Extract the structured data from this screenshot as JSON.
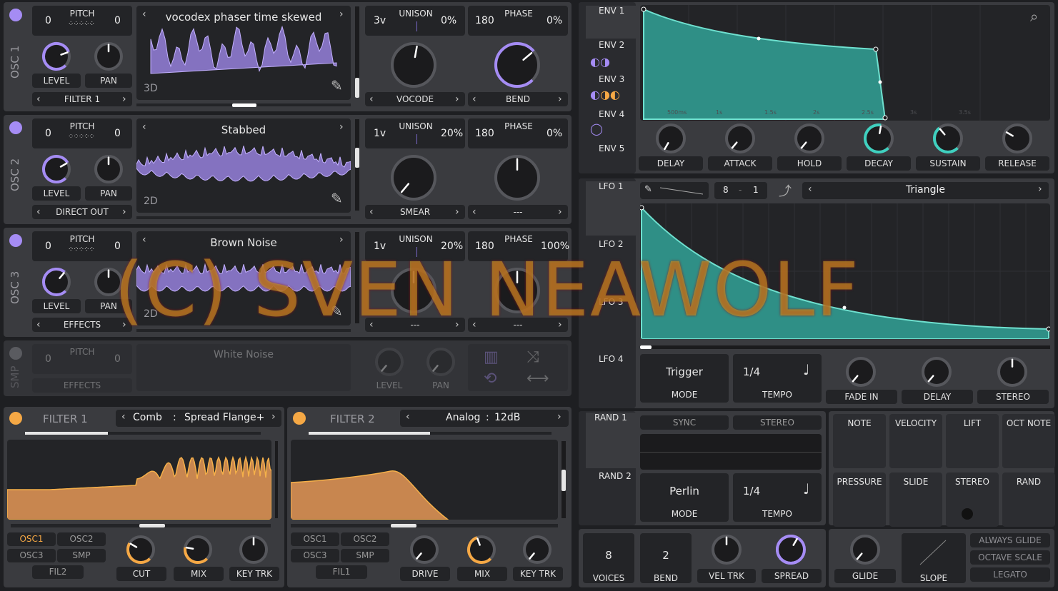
{
  "osc": [
    {
      "title": "OSC 1",
      "pitch_label": "PITCH",
      "pitch_left": "0",
      "pitch_right": "0",
      "level": "LEVEL",
      "pan": "PAN",
      "dest": "FILTER 1",
      "wave_name": "vocodex phaser time skewed",
      "mode": "3D",
      "unison_label": "UNISON",
      "voices": "3v",
      "detune": "0%",
      "phase_label": "PHASE",
      "phase": "180",
      "phase_rand": "0%",
      "knob1": "VOCODE",
      "knob2": "BEND"
    },
    {
      "title": "OSC 2",
      "pitch_label": "PITCH",
      "pitch_left": "0",
      "pitch_right": "0",
      "level": "LEVEL",
      "pan": "PAN",
      "dest": "DIRECT OUT",
      "wave_name": "Stabbed",
      "mode": "2D",
      "unison_label": "UNISON",
      "voices": "1v",
      "detune": "20%",
      "phase_label": "PHASE",
      "phase": "180",
      "phase_rand": "0%",
      "knob1": "SMEAR",
      "knob2": "---"
    },
    {
      "title": "OSC 3",
      "pitch_label": "PITCH",
      "pitch_left": "0",
      "pitch_right": "0",
      "level": "LEVEL",
      "pan": "PAN",
      "dest": "EFFECTS",
      "wave_name": "Brown Noise",
      "mode": "2D",
      "unison_label": "UNISON",
      "voices": "1v",
      "detune": "20%",
      "phase_label": "PHASE",
      "phase": "180",
      "phase_rand": "100%",
      "knob1": "---",
      "knob2": "---"
    }
  ],
  "smp": {
    "title": "SMP",
    "pitch_label": "PITCH",
    "pitch_left": "0",
    "pitch_right": "0",
    "dest": "EFFECTS",
    "sample": "White Noise",
    "level": "LEVEL",
    "pan": "PAN"
  },
  "filter1": {
    "title": "FILTER 1",
    "type": "Comb",
    "sep": ":",
    "model": "Spread Flange+",
    "routes": [
      "OSC1",
      "OSC2",
      "OSC3",
      "SMP",
      "FIL2"
    ],
    "knobs": [
      "CUT",
      "MIX",
      "KEY TRK"
    ]
  },
  "filter2": {
    "title": "FILTER 2",
    "type": "Analog",
    "sep": ":",
    "model": "12dB",
    "routes": [
      "OSC1",
      "OSC2",
      "OSC3",
      "SMP",
      "FIL1"
    ],
    "knobs": [
      "DRIVE",
      "MIX",
      "KEY TRK"
    ]
  },
  "env": {
    "tabs": [
      "ENV 1",
      "ENV 2",
      "ENV 3",
      "ENV 4",
      "ENV 5"
    ],
    "knobs": [
      "DELAY",
      "ATTACK",
      "HOLD",
      "DECAY",
      "SUSTAIN",
      "RELEASE"
    ],
    "grid": [
      "500ms",
      "1s",
      "1.5s",
      "2s",
      "2.5s",
      "3s",
      "3.5s"
    ]
  },
  "lfo": {
    "tabs": [
      "LFO 1",
      "LFO 2",
      "LFO 3",
      "LFO 4"
    ],
    "rate_num": "8",
    "rate_sep": "-",
    "rate_den": "1",
    "shape": "Triangle",
    "mode_value": "Trigger",
    "mode_label": "MODE",
    "tempo_value": "1/4",
    "tempo_label": "TEMPO",
    "knobs": [
      "FADE IN",
      "DELAY",
      "STEREO"
    ]
  },
  "rand": {
    "tabs": [
      "RAND 1",
      "RAND 2"
    ],
    "sync": "SYNC",
    "stereo": "STEREO",
    "mode_value": "Perlin",
    "mode_label": "MODE",
    "tempo_value": "1/4",
    "tempo_label": "TEMPO"
  },
  "mods": [
    "NOTE",
    "VELOCITY",
    "LIFT",
    "OCT NOTE",
    "PRESSURE",
    "SLIDE",
    "STEREO",
    "RAND"
  ],
  "voice": {
    "voices": "8",
    "voices_label": "VOICES",
    "bend": "2",
    "bend_label": "BEND",
    "vel": "VEL TRK",
    "spread": "SPREAD",
    "glide": "GLIDE",
    "slope": "SLOPE",
    "opts": [
      "ALWAYS GLIDE",
      "OCTAVE SCALE",
      "LEGATO"
    ]
  },
  "watermark": "(C) SVEN NEAWOLF",
  "colors": {
    "accent_purple": "#a58cf4",
    "accent_orange": "#f5a845",
    "teal": "#3fb7a6"
  }
}
